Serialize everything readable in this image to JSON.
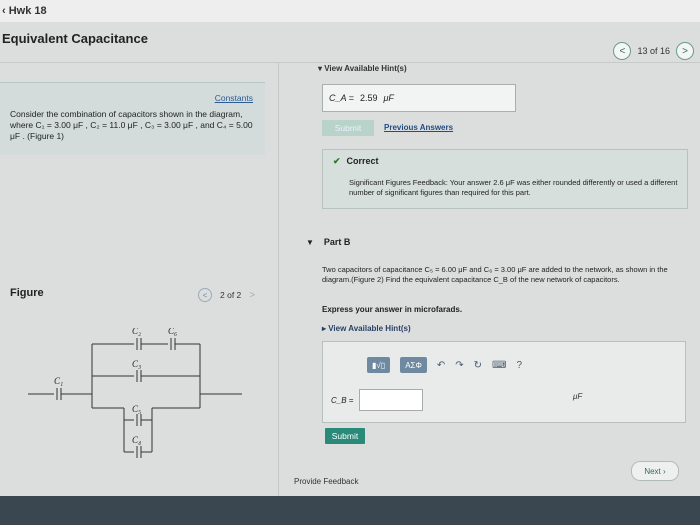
{
  "header": {
    "back_label": "Hwk 18",
    "title": "Equivalent Capacitance"
  },
  "nav": {
    "prev_icon": "<",
    "counter": "13 of 16",
    "next_icon": ">"
  },
  "hints_top": "▾ View Available Hint(s)",
  "problem": {
    "constants": "Constants",
    "text": "Consider the combination of capacitors shown in the diagram, where C₁ = 3.00 μF , C₂ = 11.0 μF , C₃ = 3.00 μF , and C₄ = 5.00 μF . (Figure 1)"
  },
  "figure": {
    "label": "Figure",
    "prev": "<",
    "counter": "2 of 2",
    "next": ">",
    "labels": {
      "c1": "C₁",
      "c2": "C₂",
      "c3": "C₃",
      "c4": "C₄",
      "c5": "C₅",
      "c6": "C₆"
    }
  },
  "part_a": {
    "answer_label": "C_A =",
    "answer_value": "2.59",
    "answer_unit": "μF",
    "submit_label": "Submit",
    "previous_answers": "Previous Answers"
  },
  "feedback": {
    "check_icon": "✔",
    "status": "Correct",
    "sigfig": "Significant Figures Feedback: Your answer 2.6 μF was either rounded differently or used a different number of significant figures than required for this part."
  },
  "part_b": {
    "title": "Part B",
    "question": "Two capacitors of capacitance C₅ = 6.00 μF and C₆ = 3.00 μF are added to the network, as shown in the diagram.(Figure 2) Find the equivalent capacitance C_B of the new network of capacitors.",
    "instruction": "Express your answer in microfarads.",
    "hint": "▸ View Available Hint(s)",
    "toolbar": {
      "template": "▮√▯",
      "greek": "ΑΣΦ",
      "undo": "↶",
      "redo": "↷",
      "reset": "↻",
      "keyboard": "⌨",
      "help": "?"
    },
    "input_label": "C_B =",
    "input_value": "",
    "unit": "μF",
    "submit_label": "Submit"
  },
  "footer": {
    "provide_feedback": "Provide Feedback",
    "next": "Next ›"
  }
}
